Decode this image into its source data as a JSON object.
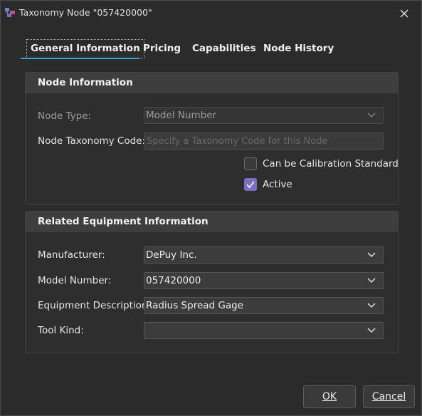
{
  "window": {
    "title": "Taxonomy Node \"057420000\""
  },
  "tabs": [
    {
      "label": "General Information"
    },
    {
      "label": "Pricing"
    },
    {
      "label": "Capabilities"
    },
    {
      "label": "Node History"
    }
  ],
  "node_info": {
    "header": "Node Information",
    "node_type_label": "Node Type:",
    "node_type_value": "Model Number",
    "taxonomy_code_label": "Node Taxonomy Code:",
    "taxonomy_code_placeholder": "Specify a Taxonomy Code for this Node",
    "calibration_label": "Can be Calibration Standard",
    "calibration_checked": false,
    "active_label": "Active",
    "active_checked": true
  },
  "related_info": {
    "header": "Related Equipment Information",
    "manufacturer_label": "Manufacturer:",
    "manufacturer_value": "DePuy Inc.",
    "model_number_label": "Model Number:",
    "model_number_value": "057420000",
    "description_label": "Equipment Description:",
    "description_value": "Radius Spread Gage",
    "tool_kind_label": "Tool Kind:",
    "tool_kind_value": ""
  },
  "buttons": {
    "ok": "OK",
    "cancel": "Cancel"
  },
  "colors": {
    "accent": "#2aa9d8",
    "checkbox_checked": "#7b6cc4",
    "background": "#2b2b2b"
  }
}
